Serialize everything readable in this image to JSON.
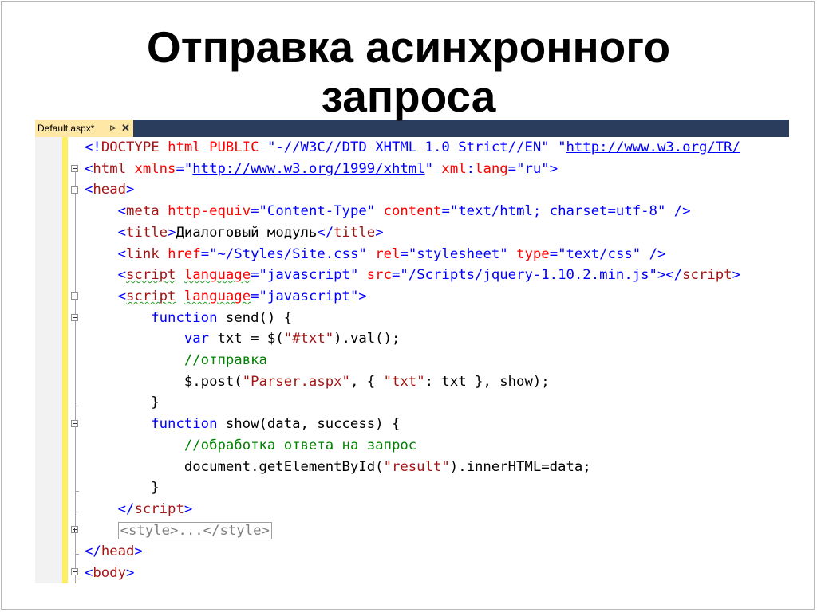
{
  "slide": {
    "title_line1": "Отправка асинхронного",
    "title_line2": "запроса"
  },
  "tab": {
    "label": "Default.aspx*",
    "pin": "⊳",
    "close": "✕"
  },
  "code_lines": [
    [
      {
        "c": "p",
        "t": "<!"
      },
      {
        "c": "t",
        "t": "DOCTYPE"
      },
      {
        "c": "",
        "t": " "
      },
      {
        "c": "a",
        "t": "html"
      },
      {
        "c": "",
        "t": " "
      },
      {
        "c": "a",
        "t": "PUBLIC"
      },
      {
        "c": "",
        "t": " "
      },
      {
        "c": "v",
        "t": "\"-//W3C//DTD XHTML 1.0 Strict//EN\""
      },
      {
        "c": "",
        "t": " "
      },
      {
        "c": "v",
        "t": "\""
      },
      {
        "c": "u",
        "t": "http://www.w3.org/TR/"
      }
    ],
    [
      {
        "c": "p",
        "t": "<"
      },
      {
        "c": "t",
        "t": "html"
      },
      {
        "c": "",
        "t": " "
      },
      {
        "c": "a",
        "t": "xmlns"
      },
      {
        "c": "p",
        "t": "=\""
      },
      {
        "c": "u",
        "t": "http://www.w3.org/1999/xhtml"
      },
      {
        "c": "p",
        "t": "\""
      },
      {
        "c": "",
        "t": " "
      },
      {
        "c": "a",
        "t": "xml"
      },
      {
        "c": "p",
        "t": ":"
      },
      {
        "c": "a",
        "t": "lang"
      },
      {
        "c": "p",
        "t": "="
      },
      {
        "c": "v",
        "t": "\"ru\""
      },
      {
        "c": "p",
        "t": ">"
      }
    ],
    [
      {
        "c": "p",
        "t": "<"
      },
      {
        "c": "t",
        "t": "head"
      },
      {
        "c": "p",
        "t": ">"
      }
    ],
    [
      {
        "c": "",
        "t": "    "
      },
      {
        "c": "p",
        "t": "<"
      },
      {
        "c": "t",
        "t": "meta"
      },
      {
        "c": "",
        "t": " "
      },
      {
        "c": "a",
        "t": "http-equiv"
      },
      {
        "c": "p",
        "t": "="
      },
      {
        "c": "v",
        "t": "\"Content-Type\""
      },
      {
        "c": "",
        "t": " "
      },
      {
        "c": "a",
        "t": "content"
      },
      {
        "c": "p",
        "t": "="
      },
      {
        "c": "v",
        "t": "\"text/html; charset=utf-8\""
      },
      {
        "c": "",
        "t": " "
      },
      {
        "c": "p",
        "t": "/>"
      }
    ],
    [
      {
        "c": "",
        "t": "    "
      },
      {
        "c": "p",
        "t": "<"
      },
      {
        "c": "t",
        "t": "title"
      },
      {
        "c": "p",
        "t": ">"
      },
      {
        "c": "",
        "t": "Диалоговый модуль"
      },
      {
        "c": "p",
        "t": "</"
      },
      {
        "c": "t",
        "t": "title"
      },
      {
        "c": "p",
        "t": ">"
      }
    ],
    [
      {
        "c": "",
        "t": "    "
      },
      {
        "c": "p",
        "t": "<"
      },
      {
        "c": "t",
        "t": "link"
      },
      {
        "c": "",
        "t": " "
      },
      {
        "c": "a",
        "t": "href"
      },
      {
        "c": "p",
        "t": "="
      },
      {
        "c": "v",
        "t": "\"~/Styles/Site.css\""
      },
      {
        "c": "",
        "t": " "
      },
      {
        "c": "a",
        "t": "rel"
      },
      {
        "c": "p",
        "t": "="
      },
      {
        "c": "v",
        "t": "\"stylesheet\""
      },
      {
        "c": "",
        "t": " "
      },
      {
        "c": "a",
        "t": "type"
      },
      {
        "c": "p",
        "t": "="
      },
      {
        "c": "v",
        "t": "\"text/css\""
      },
      {
        "c": "",
        "t": " "
      },
      {
        "c": "p",
        "t": "/>"
      }
    ],
    [
      {
        "c": "",
        "t": "    "
      },
      {
        "c": "p",
        "t": "<"
      },
      {
        "c": "t sq",
        "t": "script"
      },
      {
        "c": "",
        "t": " "
      },
      {
        "c": "a sq",
        "t": "language"
      },
      {
        "c": "p",
        "t": "="
      },
      {
        "c": "v",
        "t": "\"javascript\""
      },
      {
        "c": "",
        "t": " "
      },
      {
        "c": "a",
        "t": "src"
      },
      {
        "c": "p",
        "t": "="
      },
      {
        "c": "v",
        "t": "\"/Scripts/jquery-1.10.2.min.js\""
      },
      {
        "c": "p",
        "t": "></"
      },
      {
        "c": "t",
        "t": "script"
      },
      {
        "c": "p",
        "t": ">"
      }
    ],
    [
      {
        "c": "",
        "t": "    "
      },
      {
        "c": "p",
        "t": "<"
      },
      {
        "c": "t sq",
        "t": "script"
      },
      {
        "c": "",
        "t": " "
      },
      {
        "c": "a sq",
        "t": "language"
      },
      {
        "c": "p",
        "t": "="
      },
      {
        "c": "v",
        "t": "\"javascript\""
      },
      {
        "c": "p",
        "t": ">"
      }
    ],
    [
      {
        "c": "",
        "t": "        "
      },
      {
        "c": "k",
        "t": "function"
      },
      {
        "c": "",
        "t": " send() {"
      }
    ],
    [
      {
        "c": "",
        "t": "            "
      },
      {
        "c": "k",
        "t": "var"
      },
      {
        "c": "",
        "t": " txt = $("
      },
      {
        "c": "s",
        "t": "\"#txt\""
      },
      {
        "c": "",
        "t": ").val();"
      }
    ],
    [
      {
        "c": "",
        "t": "            "
      },
      {
        "c": "c",
        "t": "//отправка"
      }
    ],
    [
      {
        "c": "",
        "t": "            $.post("
      },
      {
        "c": "s",
        "t": "\"Parser.aspx\""
      },
      {
        "c": "",
        "t": ", { "
      },
      {
        "c": "s",
        "t": "\"txt\""
      },
      {
        "c": "",
        "t": ": txt }, show);"
      }
    ],
    [
      {
        "c": "",
        "t": "        }"
      }
    ],
    [
      {
        "c": "",
        "t": "        "
      },
      {
        "c": "k",
        "t": "function"
      },
      {
        "c": "",
        "t": " show(data, success) {"
      }
    ],
    [
      {
        "c": "",
        "t": "            "
      },
      {
        "c": "c",
        "t": "//обработка ответа на запрос"
      }
    ],
    [
      {
        "c": "",
        "t": "            document.getElementById("
      },
      {
        "c": "s",
        "t": "\"result\""
      },
      {
        "c": "",
        "t": ").innerHTML=data;"
      }
    ],
    [
      {
        "c": "",
        "t": "        }"
      }
    ],
    [
      {
        "c": "",
        "t": "    "
      },
      {
        "c": "p",
        "t": "</"
      },
      {
        "c": "t",
        "t": "script"
      },
      {
        "c": "p",
        "t": ">"
      }
    ],
    [
      {
        "c": "",
        "t": "    "
      },
      {
        "c": "collapsed-box",
        "t": "<style>...</style>"
      }
    ],
    [
      {
        "c": "p",
        "t": "</"
      },
      {
        "c": "t",
        "t": "head"
      },
      {
        "c": "p",
        "t": ">"
      }
    ],
    [
      {
        "c": "p",
        "t": "<"
      },
      {
        "c": "t",
        "t": "body"
      },
      {
        "c": "p",
        "t": ">"
      }
    ]
  ]
}
